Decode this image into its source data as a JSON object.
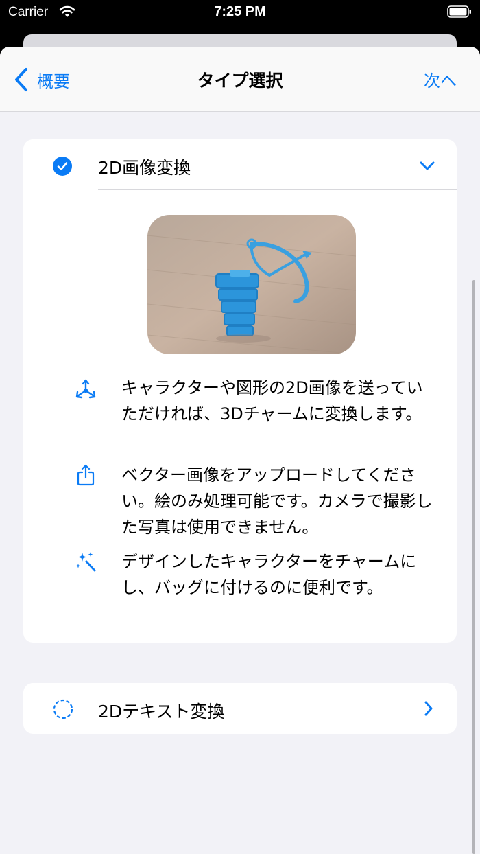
{
  "status_bar": {
    "carrier": "Carrier",
    "time": "7:25 PM"
  },
  "nav": {
    "back_label": "概要",
    "title": "タイプ選択",
    "next_label": "次へ"
  },
  "options": [
    {
      "title": "2D画像変換",
      "selected": true,
      "expanded": true,
      "features": [
        {
          "icon": "3d-axes-icon",
          "text": "キャラクターや図形の2D画像を送っていただければ、3Dチャームに変換します。"
        },
        {
          "icon": "share-upload-icon",
          "text": "ベクター画像をアップロードしてください。絵のみ処理可能です。カメラで撮影した写真は使用できません。"
        },
        {
          "icon": "sparkles-wand-icon",
          "text": "デザインしたキャラクターをチャームにし、バッグに付けるのに便利です。"
        }
      ]
    },
    {
      "title": "2Dテキスト変換",
      "selected": false,
      "expanded": false
    }
  ],
  "colors": {
    "accent": "#0a7bf5",
    "background": "#f2f2f7",
    "card": "#ffffff"
  }
}
